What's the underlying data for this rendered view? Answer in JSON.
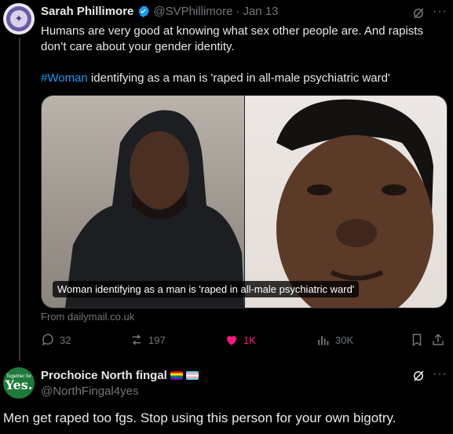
{
  "tweet": {
    "author_name": "Sarah Phillimore",
    "handle": "@SVPhillimore",
    "separator": "·",
    "date": "Jan 13",
    "more_label": "···",
    "text_line1": "Humans are very good at knowing what sex other people are. And rapists",
    "text_line2": "don’t care about your gender identity.",
    "hashtag": "#Woman",
    "text_line3_rest": " identifying as a man is 'raped in all-male psychiatric ward'",
    "media_caption": "Woman identifying as a man is 'raped in all-male psychiatric ward'",
    "source": "From dailymail.co.uk",
    "stats": {
      "replies": "32",
      "reposts": "197",
      "likes": "1K",
      "views": "30K"
    },
    "colors": {
      "accent": "#1d9bf0",
      "like": "#f91880",
      "muted": "#71767b"
    }
  },
  "reply": {
    "author_name": "Prochoice North fingal",
    "handle": "@NorthFingal4yes",
    "avatar_small_text": "Together for",
    "avatar_big_text": "Yes.",
    "more_label": "···",
    "text": "Men get raped too fgs. Stop using this person for your own bigotry."
  },
  "icons": [
    "verified-badge-icon",
    "grok-icon",
    "more-icon",
    "reply-icon",
    "repost-icon",
    "like-icon",
    "views-icon",
    "bookmark-icon",
    "share-icon",
    "rainbow-flag-icon",
    "trans-flag-icon"
  ]
}
